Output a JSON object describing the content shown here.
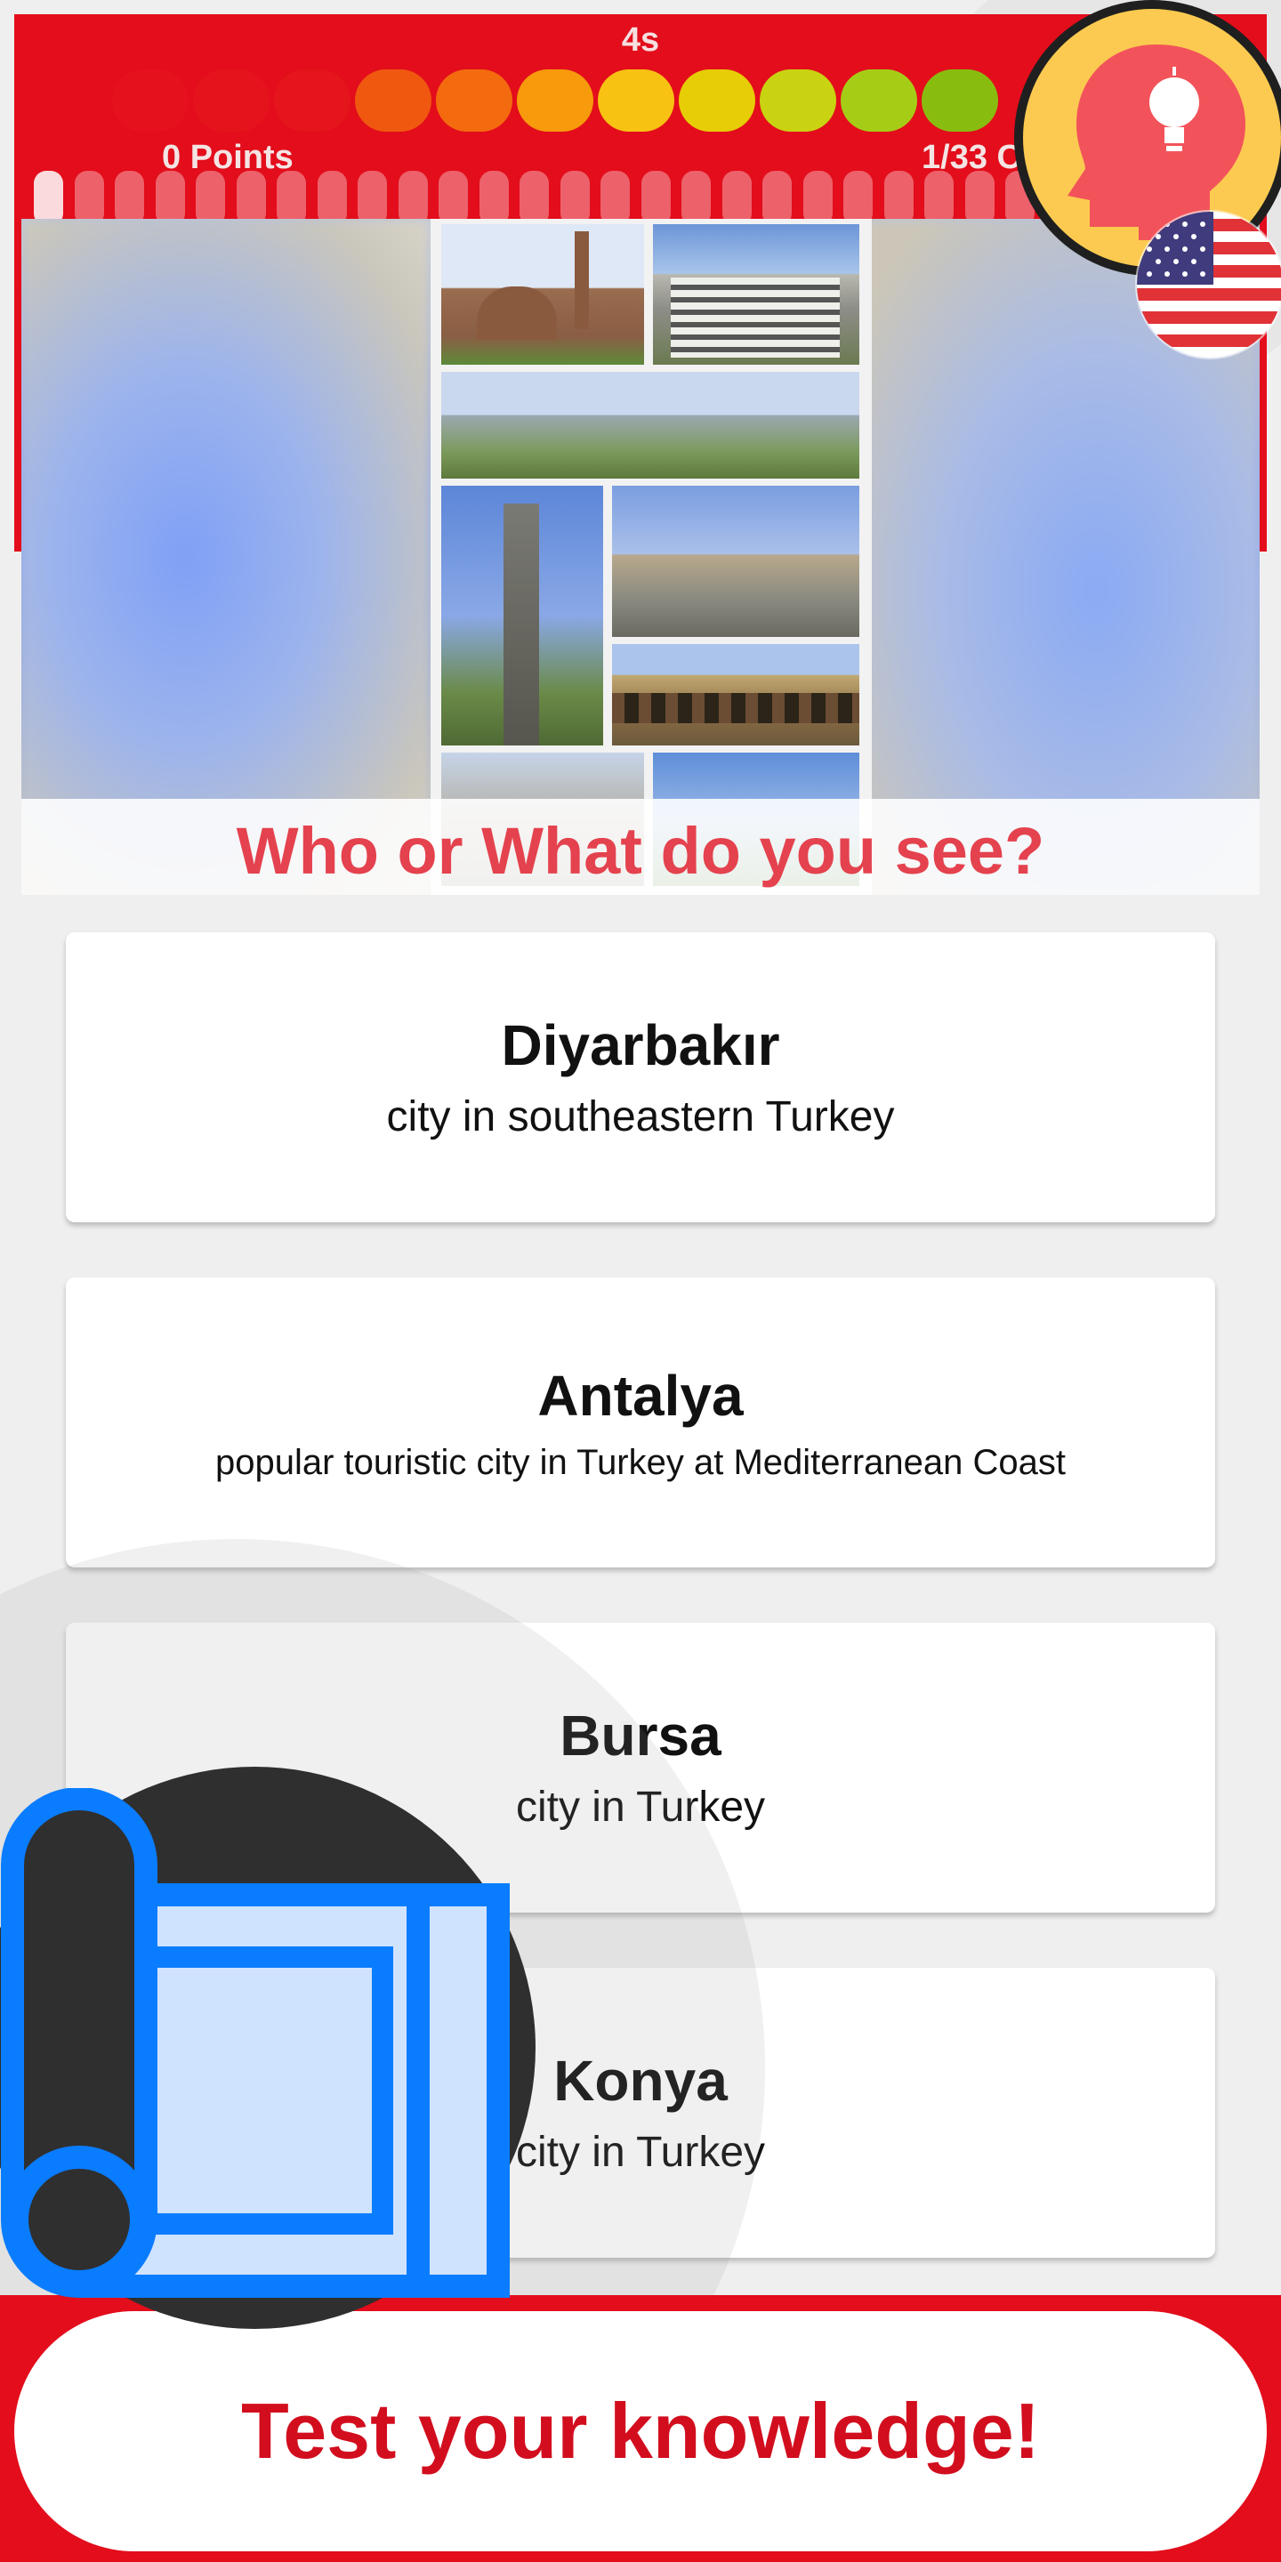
{
  "header": {
    "timer": "4s",
    "points": "0 Points",
    "counter": "1/33 C",
    "dot_colors": [
      "#e5121d",
      "#e5141c",
      "#e5151c",
      "#f05810",
      "#f36b0e",
      "#f79a0c",
      "#f7c212",
      "#e7cd06",
      "#c9d312",
      "#a6cd16",
      "#88bd10"
    ],
    "segment_count": 26
  },
  "question": "Who or What do you see?",
  "answers": [
    {
      "name": "Diyarbakır",
      "desc": "city in southeastern Turkey"
    },
    {
      "name": "Antalya",
      "desc": "popular touristic city in Turkey at Mediterranean Coast"
    },
    {
      "name": "Bursa",
      "desc": "city in Turkey"
    },
    {
      "name": "Konya",
      "desc": "city in Turkey"
    }
  ],
  "cta": "Test your knowledge!",
  "icons": {
    "hint": "head-lightbulb-icon",
    "flag": "us-flag-icon",
    "scroll": "scroll-icon"
  },
  "colors": {
    "brand_red": "#e30d1b",
    "question_red": "#e4424e",
    "cta_red": "#d20e1e",
    "hint_yellow": "#fcca50",
    "scroll_blue": "#0a7cff"
  }
}
